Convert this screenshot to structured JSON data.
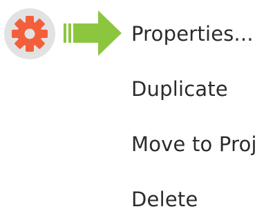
{
  "colors": {
    "gear": "#f45f3b",
    "gear_badge": "#e2e2e2",
    "arrow": "#8cc63f",
    "menu_text": "#2b2b2b"
  },
  "icons": {
    "gear": "gear-icon",
    "pointer": "arrow-right-icon"
  },
  "context_menu": {
    "items": [
      {
        "label": "Properties..."
      },
      {
        "label": "Duplicate"
      },
      {
        "label": "Move to Proj"
      },
      {
        "label": "Delete"
      }
    ]
  }
}
